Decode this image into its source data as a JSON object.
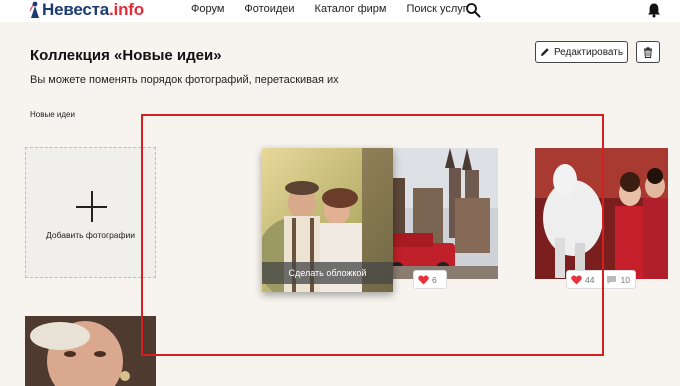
{
  "header": {
    "logo": {
      "main": "Невеста",
      "suffix": ".info"
    },
    "nav": [
      {
        "label": "Форум"
      },
      {
        "label": "Фотоидеи"
      },
      {
        "label": "Каталог фирм"
      },
      {
        "label": "Поиск услуг"
      }
    ]
  },
  "page": {
    "title": "Коллекция «Новые идеи»",
    "subtitle": "Вы можете поменять порядок фотографий, перетаскивая их",
    "edit_label": "Редактировать",
    "section_label": "Новые идеи",
    "add_photo_label": "Добавить фотографии"
  },
  "photos": [
    {
      "id": "couple",
      "cover_label": "Сделать обложкой"
    },
    {
      "id": "castle",
      "likes": "6"
    },
    {
      "id": "winter",
      "likes": "44",
      "comments": "10"
    },
    {
      "id": "portrait"
    }
  ],
  "colors": {
    "brand": "#1c3b74",
    "brand_accent": "#e52c39",
    "like": "#e8323c",
    "highlight": "#d42020"
  }
}
